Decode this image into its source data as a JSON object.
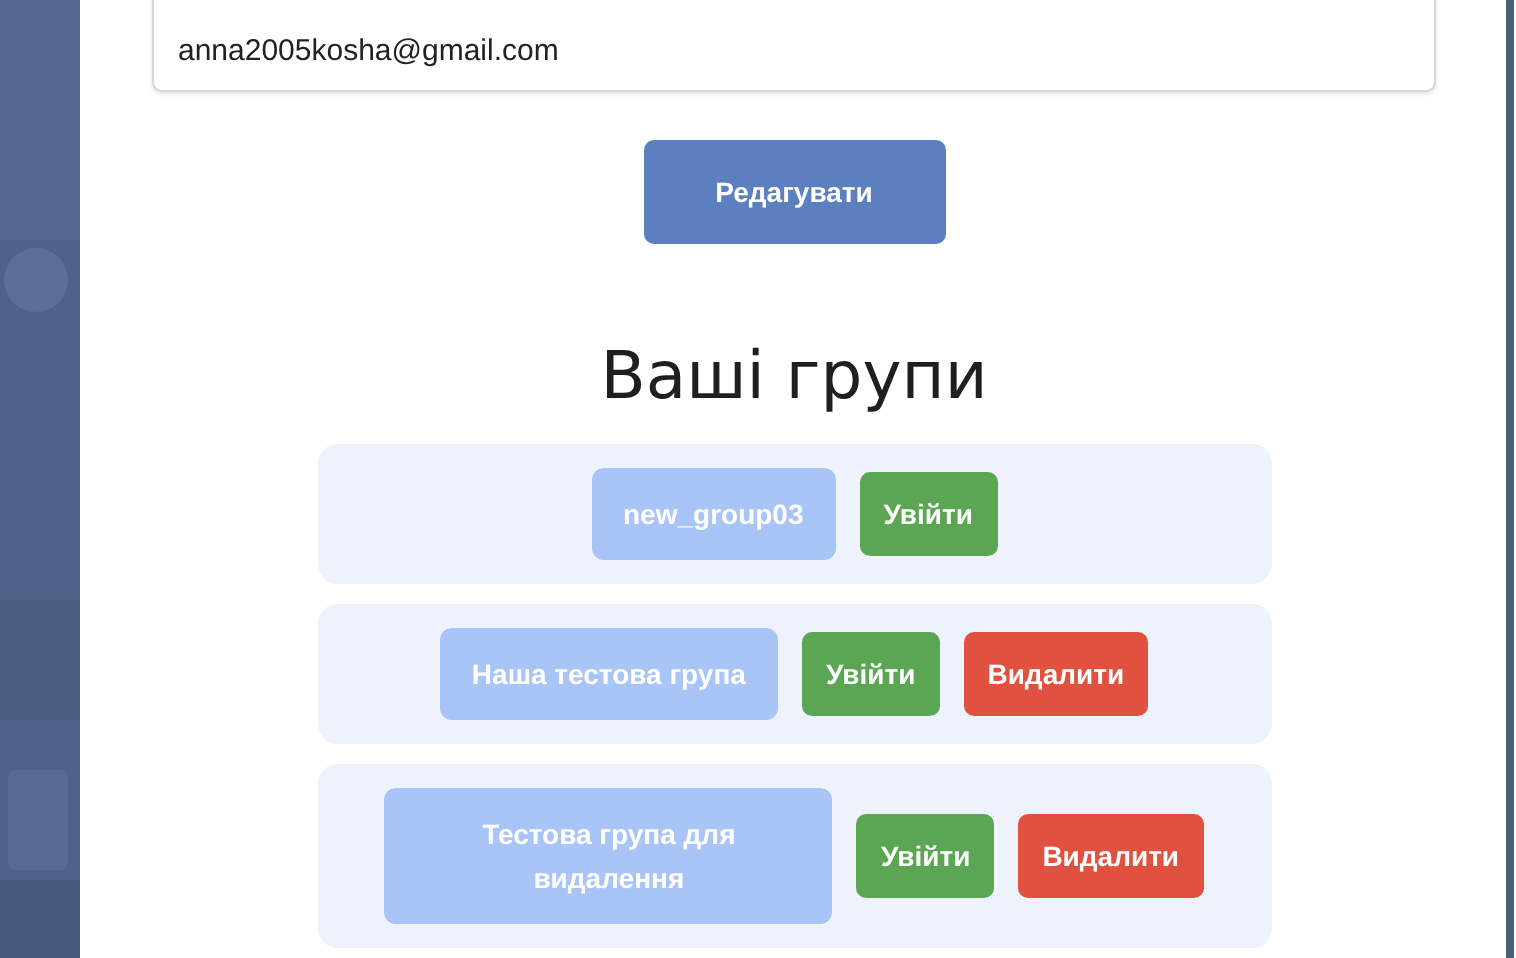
{
  "profile": {
    "email": "anna2005kosha@gmail.com",
    "edit_button": "Редагувати"
  },
  "groups_heading": "Ваші групи",
  "groups": [
    {
      "name": "new_group03",
      "actions": [
        {
          "kind": "enter",
          "label": "Увійти"
        }
      ]
    },
    {
      "name": "Наша тестова група",
      "actions": [
        {
          "kind": "enter",
          "label": "Увійти"
        },
        {
          "kind": "delete",
          "label": "Видалити"
        }
      ]
    },
    {
      "name": "Тестова група для видалення",
      "actions": [
        {
          "kind": "enter",
          "label": "Увійти"
        },
        {
          "kind": "delete",
          "label": "Видалити"
        }
      ]
    }
  ]
}
